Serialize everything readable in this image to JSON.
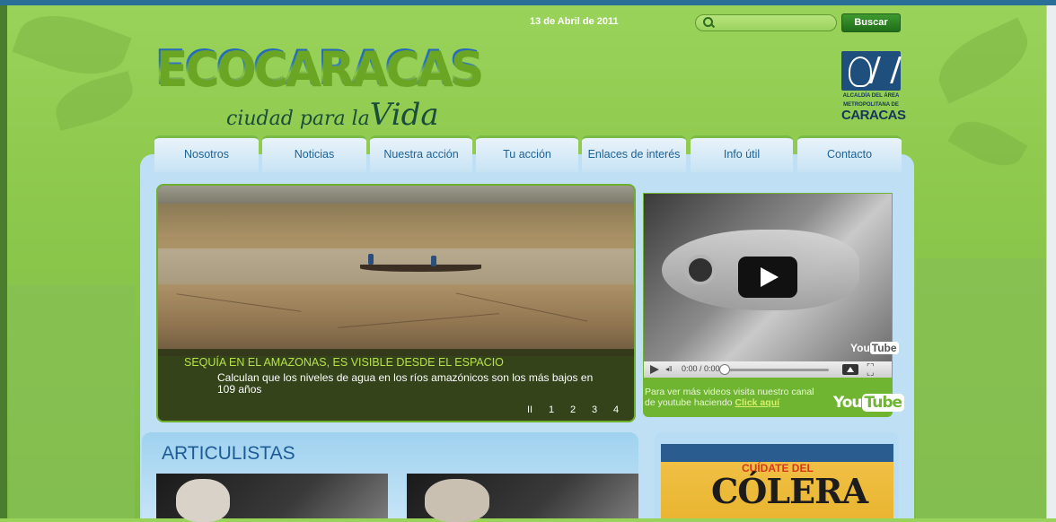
{
  "header": {
    "date": "13 de Abril de 2011",
    "search_placeholder": "",
    "search_button": "Buscar"
  },
  "logo": {
    "main": "ECOCARACAS",
    "sub_pre": "ciudad para la",
    "sub_big": "Vida"
  },
  "alcaldia": {
    "line1": "ALCALDÍA DEL ÁREA",
    "line2": "METROPOLITANA DE",
    "line3": "CARACAS"
  },
  "nav": [
    {
      "label": "Nosotros"
    },
    {
      "label": "Noticias"
    },
    {
      "label": "Nuestra acción"
    },
    {
      "label": "Tu acción"
    },
    {
      "label": "Enlaces de interés"
    },
    {
      "label": "Info útil"
    },
    {
      "label": "Contacto"
    }
  ],
  "slider": {
    "title": "SEQUÍA EN EL AMAZONAS, ES VISIBLE DESDE EL ESPACIO",
    "text": "Calculan que los niveles de agua en los ríos amazónicos son los más bajos en 109 años",
    "pager": [
      "II",
      "1",
      "2",
      "3",
      "4"
    ]
  },
  "video": {
    "time": "0:00 / 0:00",
    "watermark_you": "You",
    "watermark_tube": "Tube",
    "note": "Para ver más videos visita nuestro canal de youtube haciendo ",
    "note_link": "Click aquí",
    "yt_you": "You",
    "yt_tube": "Tube"
  },
  "articles": {
    "title": "ARTICULISTAS"
  },
  "cholera": {
    "top": "CUÍDATE DEL",
    "main": "CÓLERA"
  }
}
